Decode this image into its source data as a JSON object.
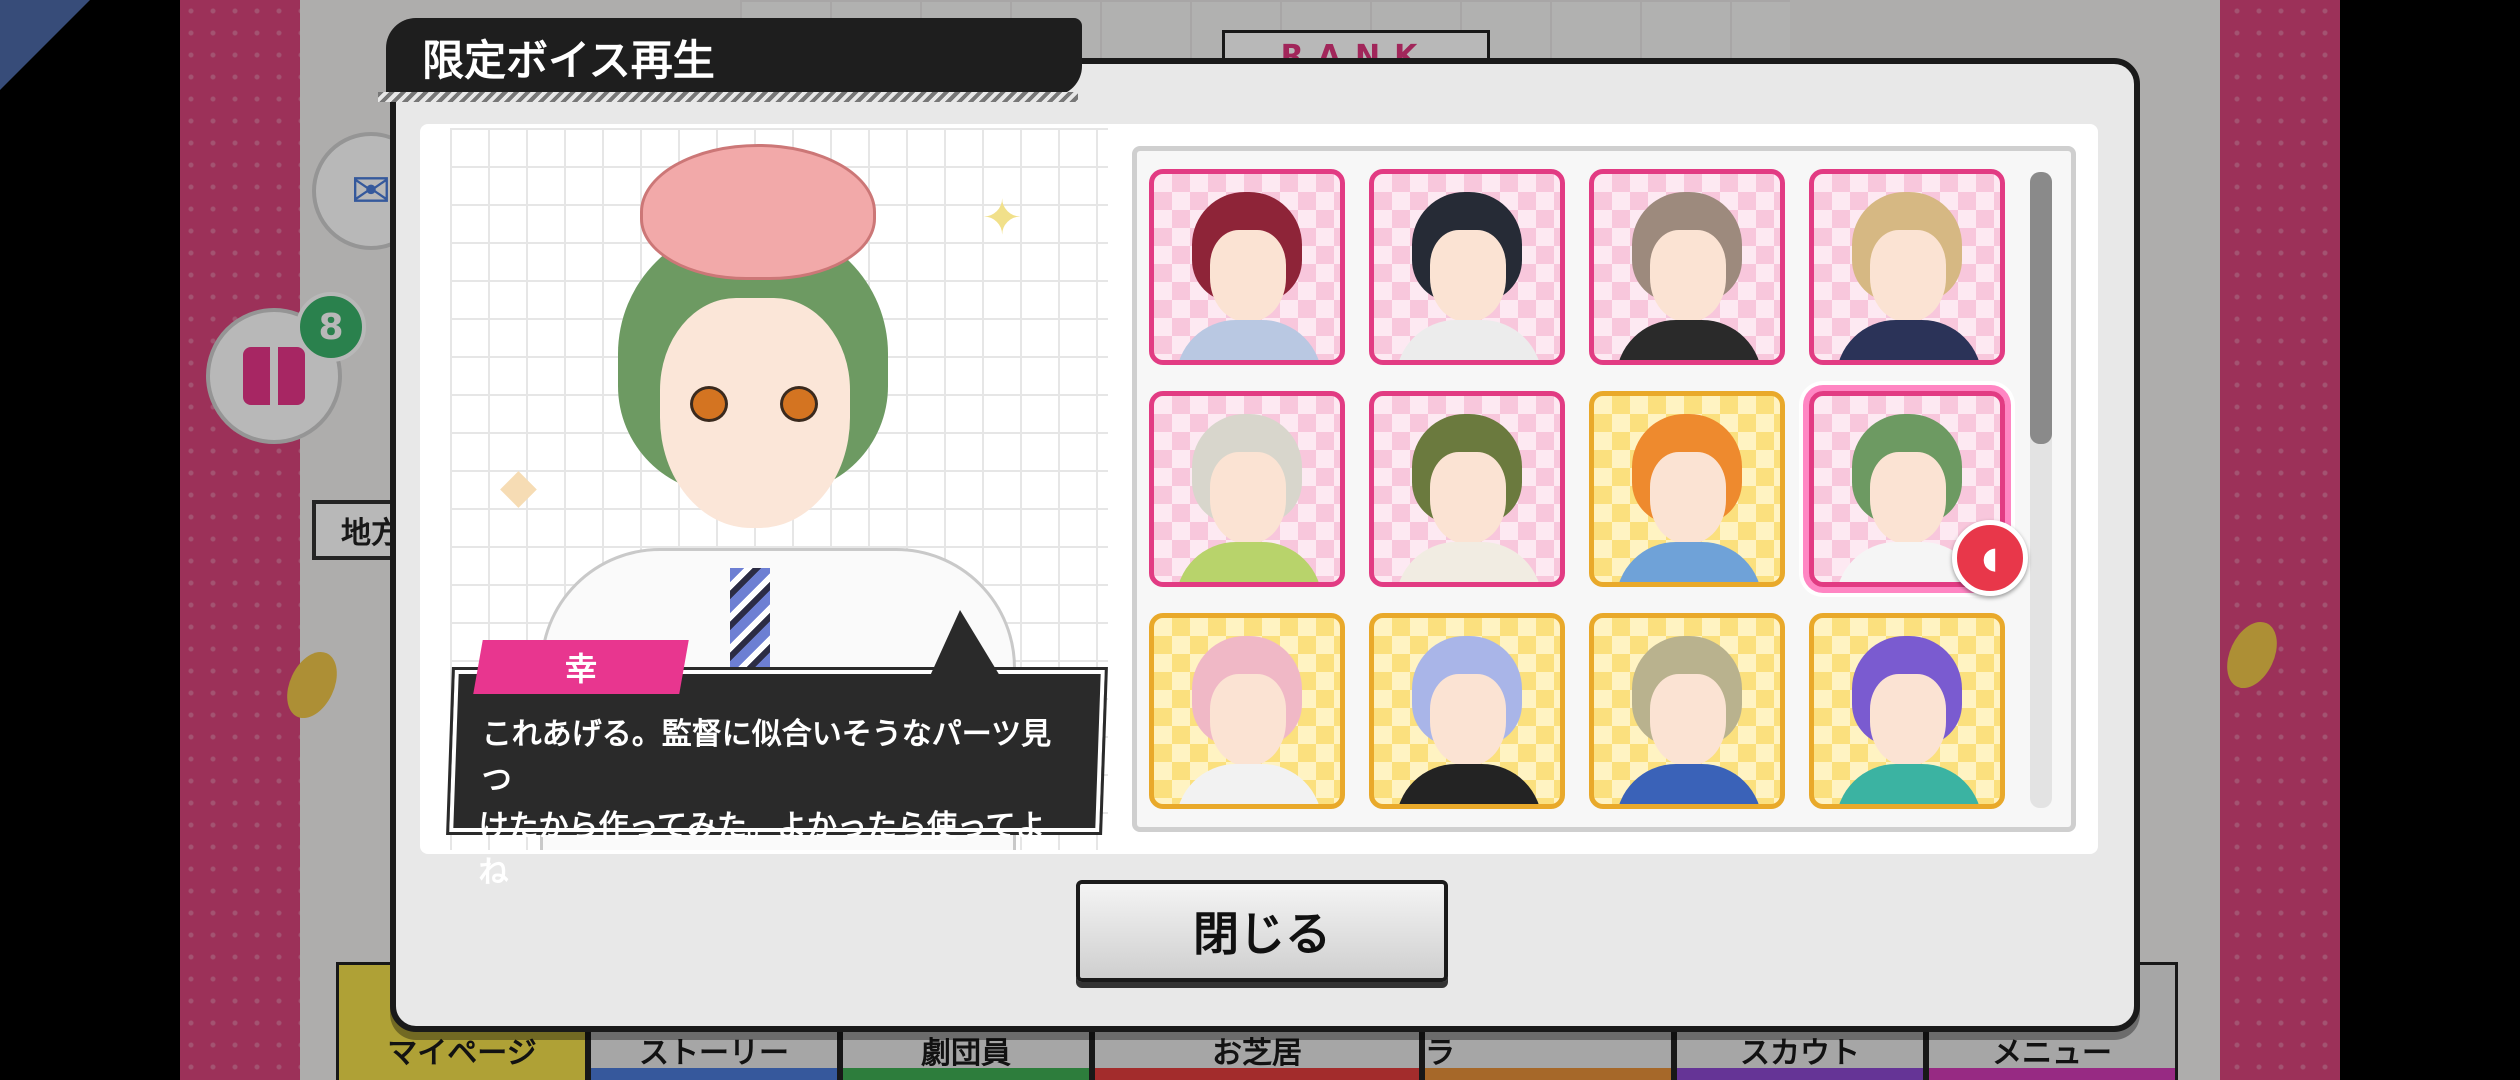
{
  "dialog": {
    "title": "限定ボイス再生",
    "speaker_name": "幸",
    "speech_line1": "これあげる。監督に似合いそうなパーツ見つ",
    "speech_line2": "けたから作ってみた。よかったら使ってよね",
    "close_label": "閉じる",
    "selected_card_index": 7
  },
  "background": {
    "gift_count": "8",
    "region_label": "地方"
  },
  "nav": [
    {
      "label": "マイページ"
    },
    {
      "label": "ストーリー"
    },
    {
      "label": "劇団員"
    },
    {
      "label": "お芝居"
    },
    {
      "label": "出稼ぎ&エクストラ"
    },
    {
      "label": "スカウト"
    },
    {
      "label": "メニュー"
    }
  ],
  "cards": [
    {
      "frame": "pink",
      "hair": "#8e2438",
      "outfit": "#b9c8e2"
    },
    {
      "frame": "pink",
      "hair": "#262b36",
      "outfit": "#ececec"
    },
    {
      "frame": "pink",
      "hair": "#9d8a7d",
      "outfit": "#2a2a2a"
    },
    {
      "frame": "pink",
      "hair": "#d6b883",
      "outfit": "#2b3358"
    },
    {
      "frame": "pink",
      "hair": "#d8d6cc",
      "outfit": "#b8d36b"
    },
    {
      "frame": "pink",
      "hair": "#6b7a3e",
      "outfit": "#f1ece2"
    },
    {
      "frame": "gold",
      "hair": "#ee8a2e",
      "outfit": "#6fa2d8"
    },
    {
      "frame": "pink",
      "hair": "#6d9a62",
      "outfit": "#f5f5f5"
    },
    {
      "frame": "gold",
      "hair": "#f0b8c6",
      "outfit": "#f2f2f2"
    },
    {
      "frame": "gold",
      "hair": "#a9b5e8",
      "outfit": "#232323"
    },
    {
      "frame": "gold",
      "hair": "#b9b28e",
      "outfit": "#3a62b8"
    },
    {
      "frame": "gold",
      "hair": "#7a5bd0",
      "outfit": "#3bb3a2"
    }
  ]
}
